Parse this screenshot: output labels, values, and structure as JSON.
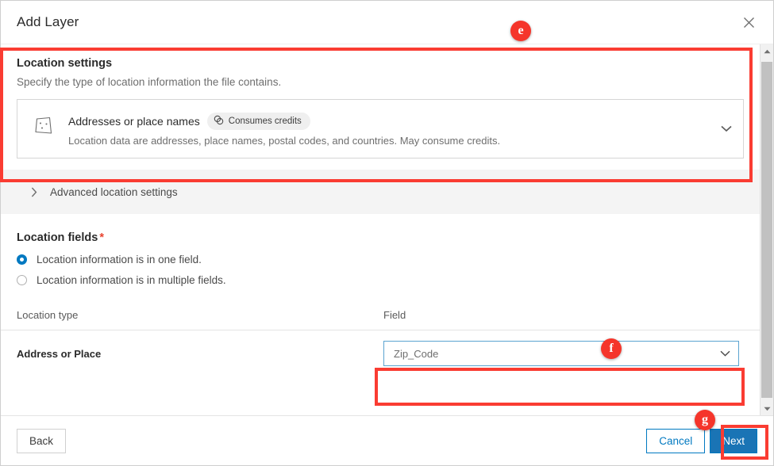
{
  "dialog": {
    "title": "Add Layer",
    "close_icon": "close-icon"
  },
  "location_settings": {
    "heading": "Location settings",
    "description": "Specify the type of location information the file contains.",
    "selected_option": {
      "icon": "polygon-map-icon",
      "name": "Addresses or place names",
      "badge_label": "Consumes credits",
      "badge_icon": "credits-coins-icon",
      "description": "Location data are addresses, place names, postal codes, and countries. May consume credits.",
      "caret_icon": "chevron-down-icon"
    }
  },
  "advanced": {
    "label": "Advanced location settings",
    "chevron_icon": "chevron-right-icon"
  },
  "location_fields": {
    "heading": "Location fields",
    "required_marker": "*",
    "options": [
      {
        "label": "Location information is in one field.",
        "checked": true
      },
      {
        "label": "Location information is in multiple fields.",
        "checked": false
      }
    ],
    "table": {
      "headers": [
        "Location type",
        "Field"
      ],
      "rows": [
        {
          "location_type": "Address or Place",
          "field_value": "Zip_Code",
          "field_caret_icon": "chevron-down-icon"
        }
      ]
    }
  },
  "footer": {
    "back_label": "Back",
    "cancel_label": "Cancel",
    "next_label": "Next"
  },
  "scrollbar": {
    "up_icon": "scroll-up-arrow-icon",
    "down_icon": "scroll-down-arrow-icon"
  },
  "annotations": {
    "badges": [
      {
        "letter": "e"
      },
      {
        "letter": "f"
      },
      {
        "letter": "g"
      }
    ],
    "highlight_color": "#fa3c32"
  }
}
